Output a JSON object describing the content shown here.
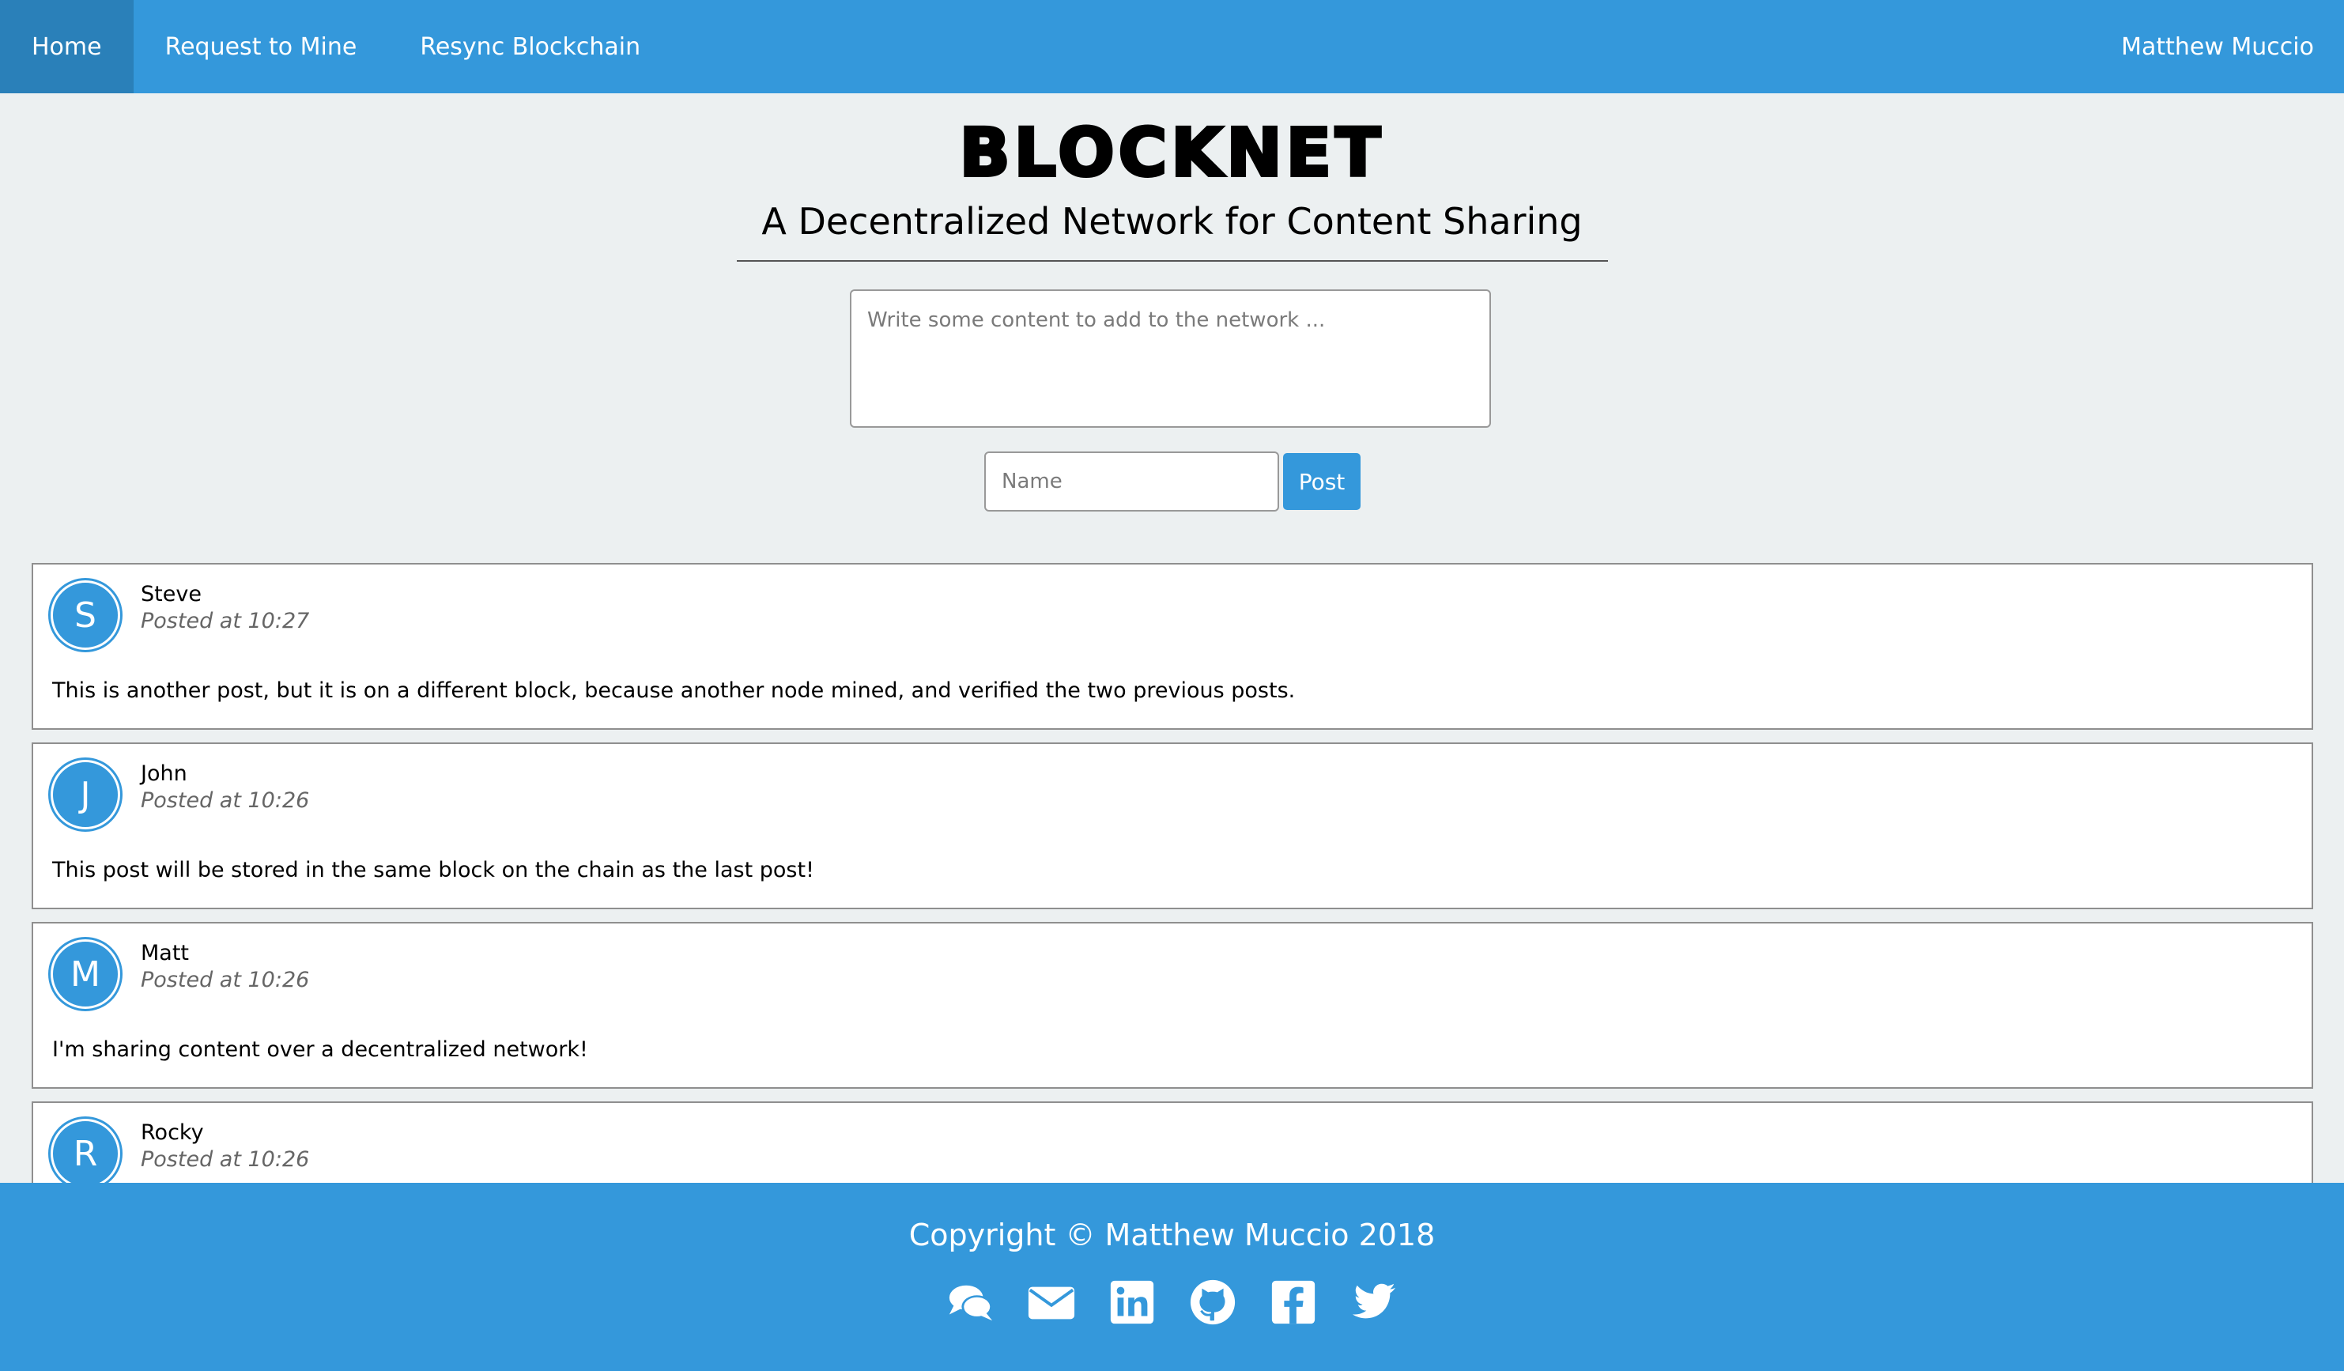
{
  "nav": {
    "items": [
      {
        "label": "Home",
        "active": true
      },
      {
        "label": "Request to Mine",
        "active": false
      },
      {
        "label": "Resync Blockchain",
        "active": false
      }
    ],
    "user": "Matthew Muccio"
  },
  "header": {
    "brand": "BLOCKNET",
    "subtitle": "A Decentralized Network for Content Sharing"
  },
  "form": {
    "content_placeholder": "Write some content to add to the network ...",
    "content_value": "",
    "name_placeholder": "Name",
    "name_value": "",
    "post_label": "Post"
  },
  "posts": [
    {
      "initial": "S",
      "author": "Steve",
      "time": "Posted at 10:27",
      "body": "This is another post, but it is on a different block, because another node mined, and verified the two previous posts."
    },
    {
      "initial": "J",
      "author": "John",
      "time": "Posted at 10:26",
      "body": "This post will be stored in the same block on the chain as the last post!"
    },
    {
      "initial": "M",
      "author": "Matt",
      "time": "Posted at 10:26",
      "body": "I'm sharing content over a decentralized network!"
    },
    {
      "initial": "R",
      "author": "Rocky",
      "time": "Posted at 10:26",
      "body": ""
    }
  ],
  "footer": {
    "copyright": "Copyright © Matthew Muccio 2018",
    "social_icons": [
      "chat-icon",
      "envelope-icon",
      "linkedin-icon",
      "github-icon",
      "facebook-icon",
      "twitter-icon"
    ]
  },
  "colors": {
    "accent": "#3498db",
    "accent_dark": "#2a80b9",
    "background": "#ecf0f1"
  }
}
